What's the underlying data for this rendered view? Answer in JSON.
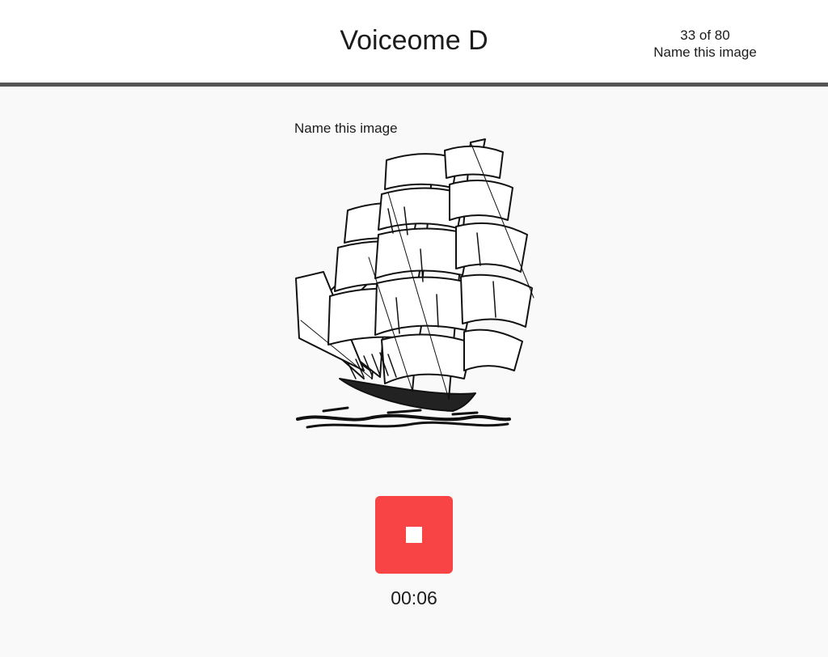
{
  "header": {
    "title": "Voiceome D",
    "progress": "33 of 80",
    "task_name": "Name this image"
  },
  "task": {
    "prompt": "Name this image",
    "image_icon": "sailing-ship-icon"
  },
  "recorder": {
    "stop_icon": "stop-icon",
    "elapsed": "00:06",
    "button_color": "#f84444"
  }
}
